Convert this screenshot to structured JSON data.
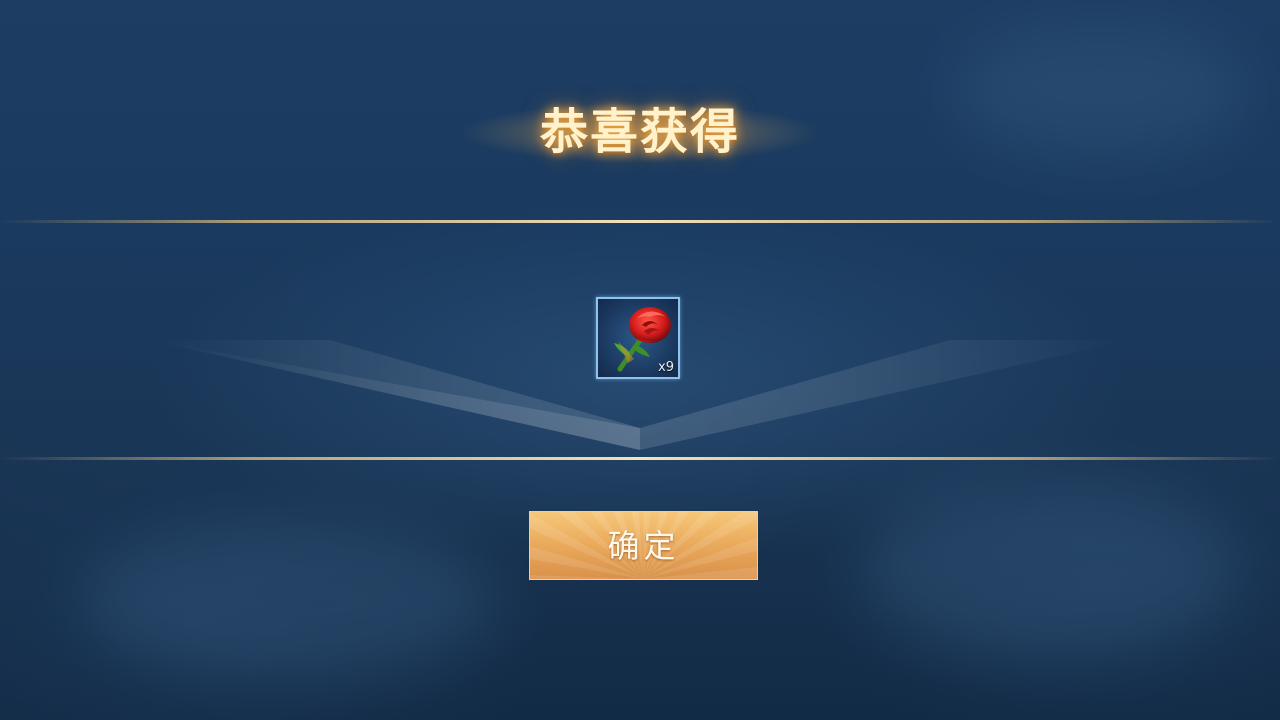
{
  "dialog": {
    "title": "恭喜获得",
    "reward": {
      "icon": "red-rose-icon",
      "count_label": "x9",
      "frame_color": "#8fc3ee"
    },
    "confirm_label": "确定"
  },
  "colors": {
    "background": "#1a3a5f",
    "title_text": "#fff2cc",
    "title_glow": "#ffb446",
    "divider": "#e6c382",
    "button": "#e9a95b"
  }
}
